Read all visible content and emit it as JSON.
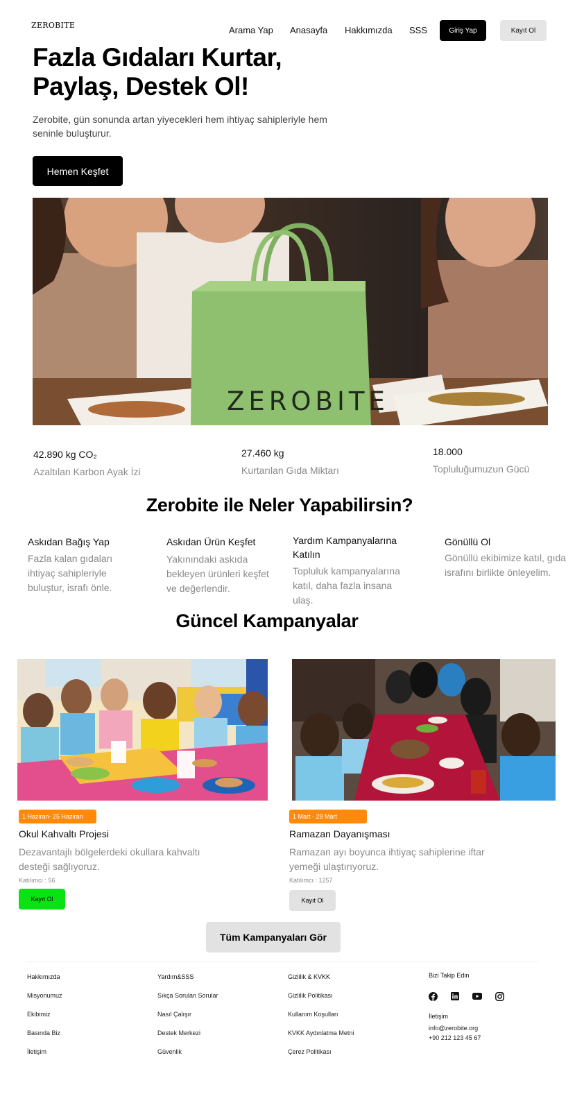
{
  "header": {
    "logo": "ZEROBITE",
    "nav": [
      "Arama Yap",
      "Anasayfa",
      "Hakkımızda",
      "SSS"
    ],
    "login_label": "Giriş Yap",
    "register_label": "Kayıt Ol"
  },
  "hero": {
    "title_line1": "Fazla Gıdaları Kurtar,",
    "title_line2": "Paylaş, Destek Ol!",
    "subtitle": "Zerobite, gün sonunda artan yiyecekleri hem ihtiyaç sahipleriyle hem seninle buluşturur.",
    "cta_label": "Hemen Keşfet",
    "image_bag_text": "ZEROBITE"
  },
  "stats": [
    {
      "value": "42.890 kg CO₂",
      "label": "Azaltılan Karbon Ayak İzi"
    },
    {
      "value": "27.460 kg",
      "label": "Kurtarılan Gıda Miktarı"
    },
    {
      "value": "18.000",
      "label": "Topluluğumuzun Gücü"
    }
  ],
  "features": {
    "title": "Zerobite ile Neler Yapabilirsin?",
    "items": [
      {
        "title": "Askıdan Bağış Yap",
        "desc": "Fazla kalan gıdaları ihtiyaç sahipleriyle buluştur, israfı önle."
      },
      {
        "title": "Askıdan Ürün Keşfet",
        "desc": "Yakınındaki askıda bekleyen ürünleri keşfet ve değerlendir."
      },
      {
        "title": "Yardım Kampanyalarına Katılın",
        "desc": "Topluluk kampanyalarına katıl, daha fazla insana ulaş."
      },
      {
        "title": "Gönüllü Ol",
        "desc": "Gönüllü ekibimize katıl, gıda israfını birlikte önleyelim."
      }
    ]
  },
  "campaigns": {
    "title": "Güncel Kampanyalar",
    "items": [
      {
        "date": "1 Haziran- 25 Haziran",
        "title": "Okul Kahvaltı Projesi",
        "desc": "Dezavantajlı bölgelerdeki okullara kahvaltı desteği sağlıyoruz.",
        "count": "Katılımcı : 56",
        "button": "Kayıt Ol"
      },
      {
        "date": "1 Mart - 29 Mart",
        "title": "Ramazan Dayanışması",
        "desc": "Ramazan ayı boyunca ihtiyaç sahiplerine iftar yemeği ulaştırıyoruz.",
        "count": "Katılımcı : 1257",
        "button": "Kayıt Ol"
      }
    ],
    "all_label": "Tüm Kampanyaları Gör"
  },
  "footer": {
    "columns": [
      {
        "title": "Hakkımızda",
        "links": [
          "Misyonumuz",
          "Ekibimiz",
          "Basında Biz",
          "İletişim"
        ]
      },
      {
        "title": "Yardım&SSS",
        "links": [
          "Sıkça Sorulan Sorular",
          "Nasıl Çalışır",
          "Destek Merkezi",
          "Güvenlik"
        ]
      },
      {
        "title": "Gizlilik & KVKK",
        "links": [
          "Gizlilik Politikası",
          "Kullanım Koşulları",
          "KVKK Aydınlatma Metni",
          "Çerez Politikası"
        ]
      }
    ],
    "follow_title": "Bizi Takip Edin",
    "social_icons": [
      "facebook-icon",
      "linkedin-icon",
      "youtube-icon",
      "instagram-icon"
    ],
    "contact_title": "İletişim",
    "email": "info@zerobite.org",
    "phone": "+90 212 123 45 67"
  },
  "colors": {
    "accent_orange": "#ff8a0a",
    "green_button": "#0be214",
    "bag_green": "#8fc06f"
  }
}
